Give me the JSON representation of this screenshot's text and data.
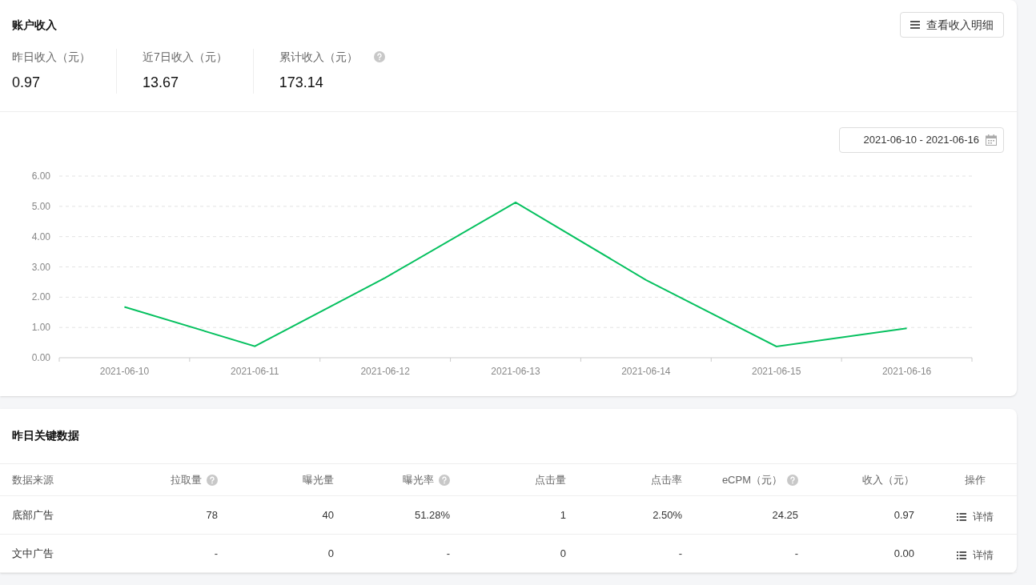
{
  "income_card": {
    "title": "账户收入",
    "detail_button": "查看收入明细",
    "stats": [
      {
        "label": "昨日收入（元）",
        "value": "0.97",
        "help": false
      },
      {
        "label": "近7日收入（元）",
        "value": "13.67",
        "help": false
      },
      {
        "label": "累计收入（元）",
        "value": "173.14",
        "help": true
      }
    ],
    "date_range": "2021-06-10 - 2021-06-16",
    "chart_data": {
      "type": "line",
      "categories": [
        "2021-06-10",
        "2021-06-11",
        "2021-06-12",
        "2021-06-13",
        "2021-06-14",
        "2021-06-15",
        "2021-06-16"
      ],
      "series": [
        {
          "color": "#07c160",
          "values": [
            1.68,
            0.38,
            2.64,
            5.13,
            2.57,
            0.37,
            0.97
          ]
        }
      ],
      "ylim": [
        0,
        6
      ],
      "grid": true,
      "yticks": [
        {
          "value": 0,
          "label": "0.00"
        },
        {
          "value": 1,
          "label": "1.00"
        },
        {
          "value": 2,
          "label": "2.00"
        },
        {
          "value": 3,
          "label": "3.00"
        },
        {
          "value": 4,
          "label": "4.00"
        },
        {
          "value": 5,
          "label": "5.00"
        },
        {
          "value": 6,
          "label": "6.00"
        }
      ]
    }
  },
  "key_data": {
    "title": "昨日关键数据",
    "columns": [
      {
        "label": "数据来源",
        "help": false
      },
      {
        "label": "拉取量",
        "help": true
      },
      {
        "label": "曝光量",
        "help": false
      },
      {
        "label": "曝光率",
        "help": true
      },
      {
        "label": "点击量",
        "help": false
      },
      {
        "label": "点击率",
        "help": false
      },
      {
        "label": "eCPM（元）",
        "help": true
      },
      {
        "label": "收入（元）",
        "help": false
      },
      {
        "label": "操作",
        "help": false
      }
    ],
    "rows": [
      {
        "cells": [
          "底部广告",
          "78",
          "40",
          "51.28%",
          "1",
          "2.50%",
          "24.25",
          "0.97"
        ],
        "action": "详情"
      },
      {
        "cells": [
          "文中广告",
          "-",
          "0",
          "-",
          "0",
          "-",
          "-",
          "0.00"
        ],
        "action": "详情"
      }
    ]
  }
}
